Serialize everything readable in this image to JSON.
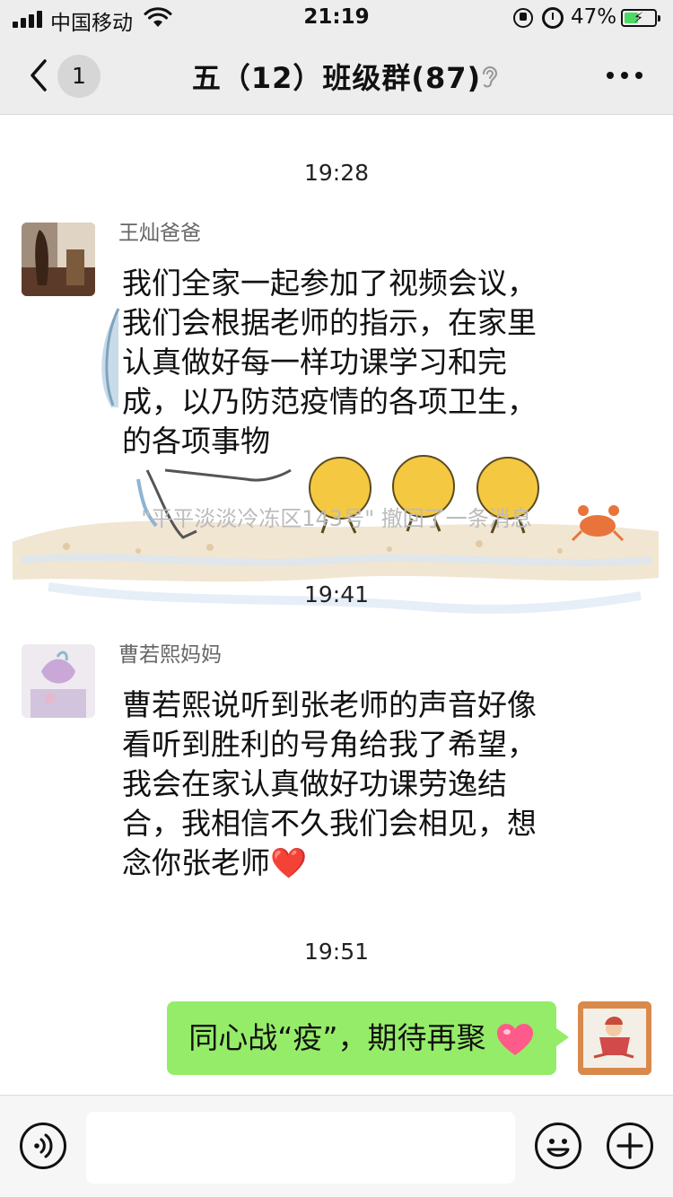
{
  "status_bar": {
    "carrier": "中国移动",
    "time": "21:19",
    "battery": "47%",
    "battery_level": 0.47,
    "icons": [
      "signal-icon",
      "wifi-icon",
      "orientation-lock-icon",
      "alarm-icon",
      "battery-charging-icon"
    ]
  },
  "nav": {
    "back_icon": "chevron-left-icon",
    "unread_count": "1",
    "title": "五（12）班级群(87)",
    "mute_icon": "ear-icon",
    "more_icon": "more-dots-icon"
  },
  "messages": [
    {
      "timestamp": "19:28",
      "sender": "王灿爸爸",
      "text": "我们全家一起参加了视频会议，我们会根据老师的指示，在家里认真做好每一样功课学习和完成，以乃防范疫情的各项卫生，的各项事物"
    },
    {
      "recall_notice": "\"平平淡淡冷冻区143号\" 撤回了一条消息"
    },
    {
      "timestamp": "19:41",
      "sender": "曹若熙妈妈",
      "text": "曹若熙说听到张老师的声音好像看听到胜利的号角给我了希望，我会在家认真做好功课劳逸结合，我相信不久我们会相见，想念你张老师",
      "emoji": "❤️"
    },
    {
      "timestamp": "19:51",
      "self": true,
      "text": "同心战“疫”，期待再聚",
      "emoji": "heart-emoji"
    }
  ],
  "input_bar": {
    "voice_icon": "voice-icon",
    "input_value": "",
    "emoji_icon": "smiley-icon",
    "plus_icon": "plus-icon"
  },
  "colors": {
    "nav_bg": "#ededed",
    "my_bubble": "#95ec69",
    "battery_fill": "#4cd964",
    "heart": "#e8234a"
  }
}
